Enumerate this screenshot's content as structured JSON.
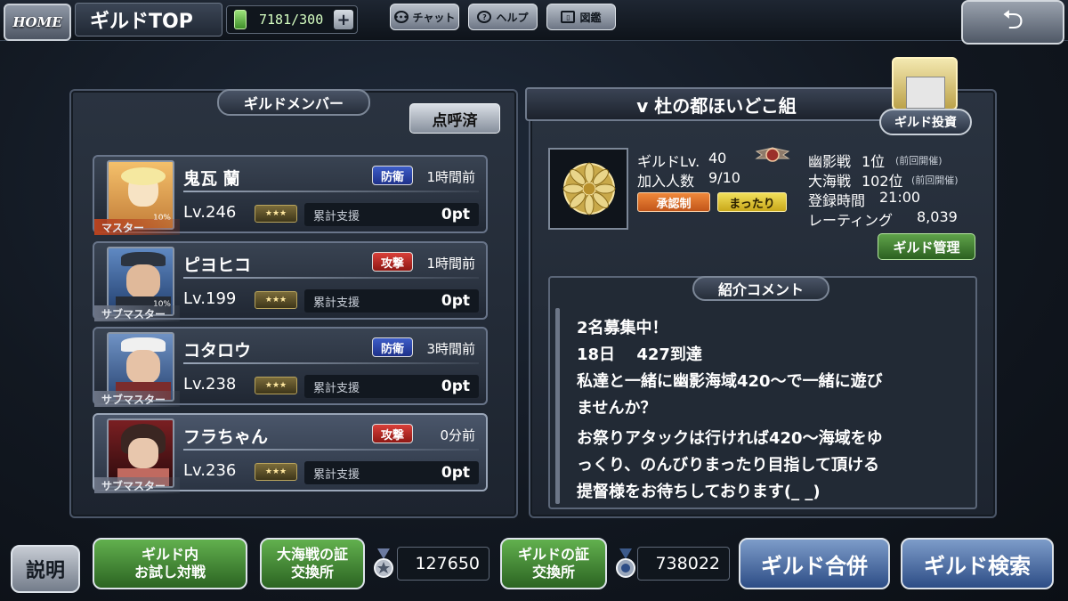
{
  "topbar": {
    "home_label": "HOME",
    "title": "ギルドTOP",
    "fuel_value": "7181/300",
    "plus_glyph": "+",
    "chat_label": "チャット",
    "help_label": "ヘルプ",
    "book_label": "図鑑",
    "back_glyph": "⮌"
  },
  "members_panel": {
    "title": "ギルドメンバー",
    "rollcall_label": "点呼済",
    "members": [
      {
        "name": "鬼瓦 蘭",
        "badge": "防衛",
        "badge_type": "def",
        "time": "1時間前",
        "level": "Lv.246",
        "support_label": "累計支援",
        "support_pt": "0pt",
        "role": "マスター",
        "avatar_note": "10%",
        "highlight": false
      },
      {
        "name": "ピヨヒコ",
        "badge": "攻撃",
        "badge_type": "atk",
        "time": "1時間前",
        "level": "Lv.199",
        "support_label": "累計支援",
        "support_pt": "0pt",
        "role": "サブマスター",
        "avatar_note": "10%",
        "highlight": false
      },
      {
        "name": "コタロウ",
        "badge": "防衛",
        "badge_type": "def",
        "time": "3時間前",
        "level": "Lv.238",
        "support_label": "累計支援",
        "support_pt": "0pt",
        "role": "サブマスター",
        "avatar_note": "",
        "highlight": false
      },
      {
        "name": "フラちゃん",
        "badge": "攻撃",
        "badge_type": "atk",
        "time": "0分前",
        "level": "Lv.236",
        "support_label": "累計支援",
        "support_pt": "0pt",
        "role": "サブマスター",
        "avatar_note": "",
        "highlight": true
      }
    ]
  },
  "guild": {
    "name": "v 杜の都ほいどこ組",
    "invest_label": "ギルド投資",
    "level_label": "ギルドLv.",
    "level_value": "40",
    "members_label": "加入人数",
    "members_value": "9/10",
    "tag_approval": "承認制",
    "tag_style": "まったり",
    "shadow_label": "幽影戦",
    "shadow_rank": "1位",
    "shadow_note": "(前回開催)",
    "sea_label": "大海戦",
    "sea_rank": "102位",
    "sea_note": "(前回開催)",
    "login_label": "登録時間",
    "login_value": "21:00",
    "rating_label": "レーティング",
    "rating_value": "8,039",
    "manage_label": "ギルド管理",
    "comment_title": "紹介コメント",
    "comment_lines": [
      "2名募集中！",
      "18日　 427到達",
      "私達と一緒に幽影海域420〜で一緒に遊び",
      "ませんか？",
      "お祭りアタックは行ければ420〜海域をゆ",
      "っくり、のんびりまったり目指して頂ける",
      "提督様をお待ちしております(_ _)"
    ]
  },
  "bottom": {
    "explain_label": "説明",
    "trial_label_1": "ギルド内",
    "trial_label_2": "お試し対戦",
    "sea_exchange_1": "大海戦の証",
    "sea_exchange_2": "交換所",
    "sea_exchange_value": "127650",
    "guild_exchange_1": "ギルドの証",
    "guild_exchange_2": "交換所",
    "guild_exchange_value": "738022",
    "merge_label": "ギルド合併",
    "search_label": "ギルド検索"
  },
  "colors": {
    "accent_green": "#62b04e",
    "accent_blue": "#2d4d86",
    "badge_def": "#3d5dc8",
    "badge_atk": "#d9403a",
    "tag_orange": "#f0883a",
    "tag_yellow": "#f1df5a"
  },
  "icons": [
    "home-button",
    "fuel-icon",
    "chat-icon",
    "help-icon",
    "book-icon",
    "back-arrow-icon",
    "guild-emblem-icon",
    "wing-emblem-icon",
    "medal-icon"
  ]
}
